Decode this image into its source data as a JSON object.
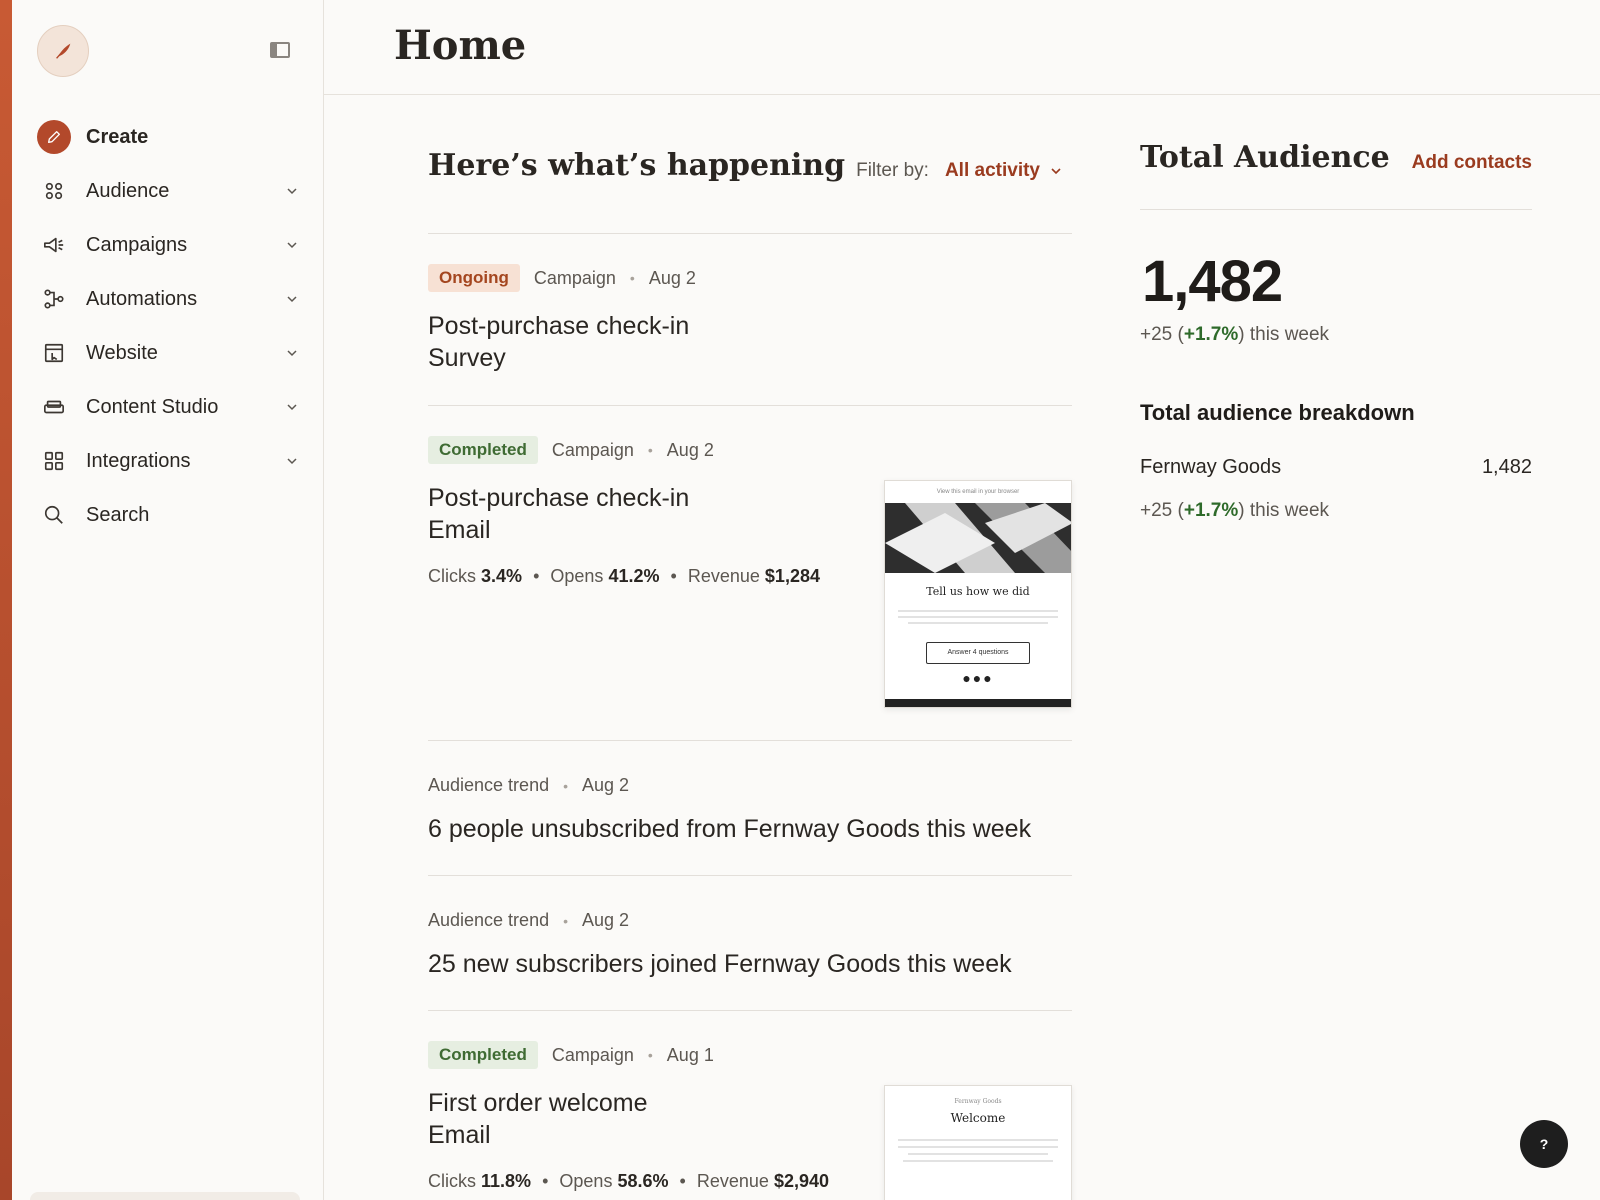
{
  "header": {
    "title": "Home"
  },
  "sidebar": {
    "create_label": "Create",
    "items": [
      {
        "label": "Audience",
        "icon": "audience-icon"
      },
      {
        "label": "Campaigns",
        "icon": "megaphone-icon"
      },
      {
        "label": "Automations",
        "icon": "automation-flow-icon"
      },
      {
        "label": "Website",
        "icon": "website-icon"
      },
      {
        "label": "Content Studio",
        "icon": "content-studio-icon"
      },
      {
        "label": "Integrations",
        "icon": "integrations-grid-icon"
      },
      {
        "label": "Search",
        "icon": "search-icon"
      }
    ]
  },
  "feed": {
    "title": "Here’s what’s happening",
    "filter_label": "Filter by:",
    "filter_value": "All activity",
    "cards": [
      {
        "badge": "Ongoing",
        "type": "Campaign",
        "date": "Aug 2",
        "title_line1": "Post-purchase check-in",
        "title_line2": "Survey"
      },
      {
        "badge": "Completed",
        "type": "Campaign",
        "date": "Aug 2",
        "title_line1": "Post-purchase check-in",
        "title_line2": "Email",
        "clicks_label": "Clicks",
        "clicks": "3.4%",
        "opens_label": "Opens",
        "opens": "41.2%",
        "revenue_label": "Revenue",
        "revenue": "$1,284",
        "thumb": {
          "top_text": "View this email in your browser",
          "heading": "Tell us how we did",
          "button": "Answer 4 questions"
        }
      },
      {
        "type": "Audience trend",
        "date": "Aug 2",
        "title": "6 people unsubscribed from Fernway Goods this week"
      },
      {
        "type": "Audience trend",
        "date": "Aug 2",
        "title": "25 new subscribers joined Fernway Goods this week"
      },
      {
        "badge": "Completed",
        "type": "Campaign",
        "date": "Aug 1",
        "title_line1": "First order welcome",
        "title_line2": "Email",
        "clicks_label": "Clicks",
        "clicks": "11.8%",
        "opens_label": "Opens",
        "opens": "58.6%",
        "revenue_label": "Revenue",
        "revenue": "$2,940",
        "thumb": {
          "brand": "Fernway Goods",
          "heading": "Welcome"
        }
      }
    ]
  },
  "audience": {
    "title": "Total Audience",
    "add_contacts": "Add contacts",
    "total": "1,482",
    "delta_prefix": "+25 (",
    "delta_pct": "+1.7%",
    "delta_suffix": ") this week",
    "breakdown_title": "Total audience breakdown",
    "breakdown": [
      {
        "name": "Fernway Goods",
        "count": "1,482",
        "delta_prefix": "+25 (",
        "delta_pct": "+1.7%",
        "delta_suffix": ") this week"
      }
    ]
  },
  "help": {
    "label": "?"
  },
  "colors": {
    "accent": "#b3492b",
    "link": "#9a3b1f",
    "positive": "#2e6a2a",
    "ongoing_bg": "#f7e1d4",
    "completed_bg": "#e6eee1"
  }
}
